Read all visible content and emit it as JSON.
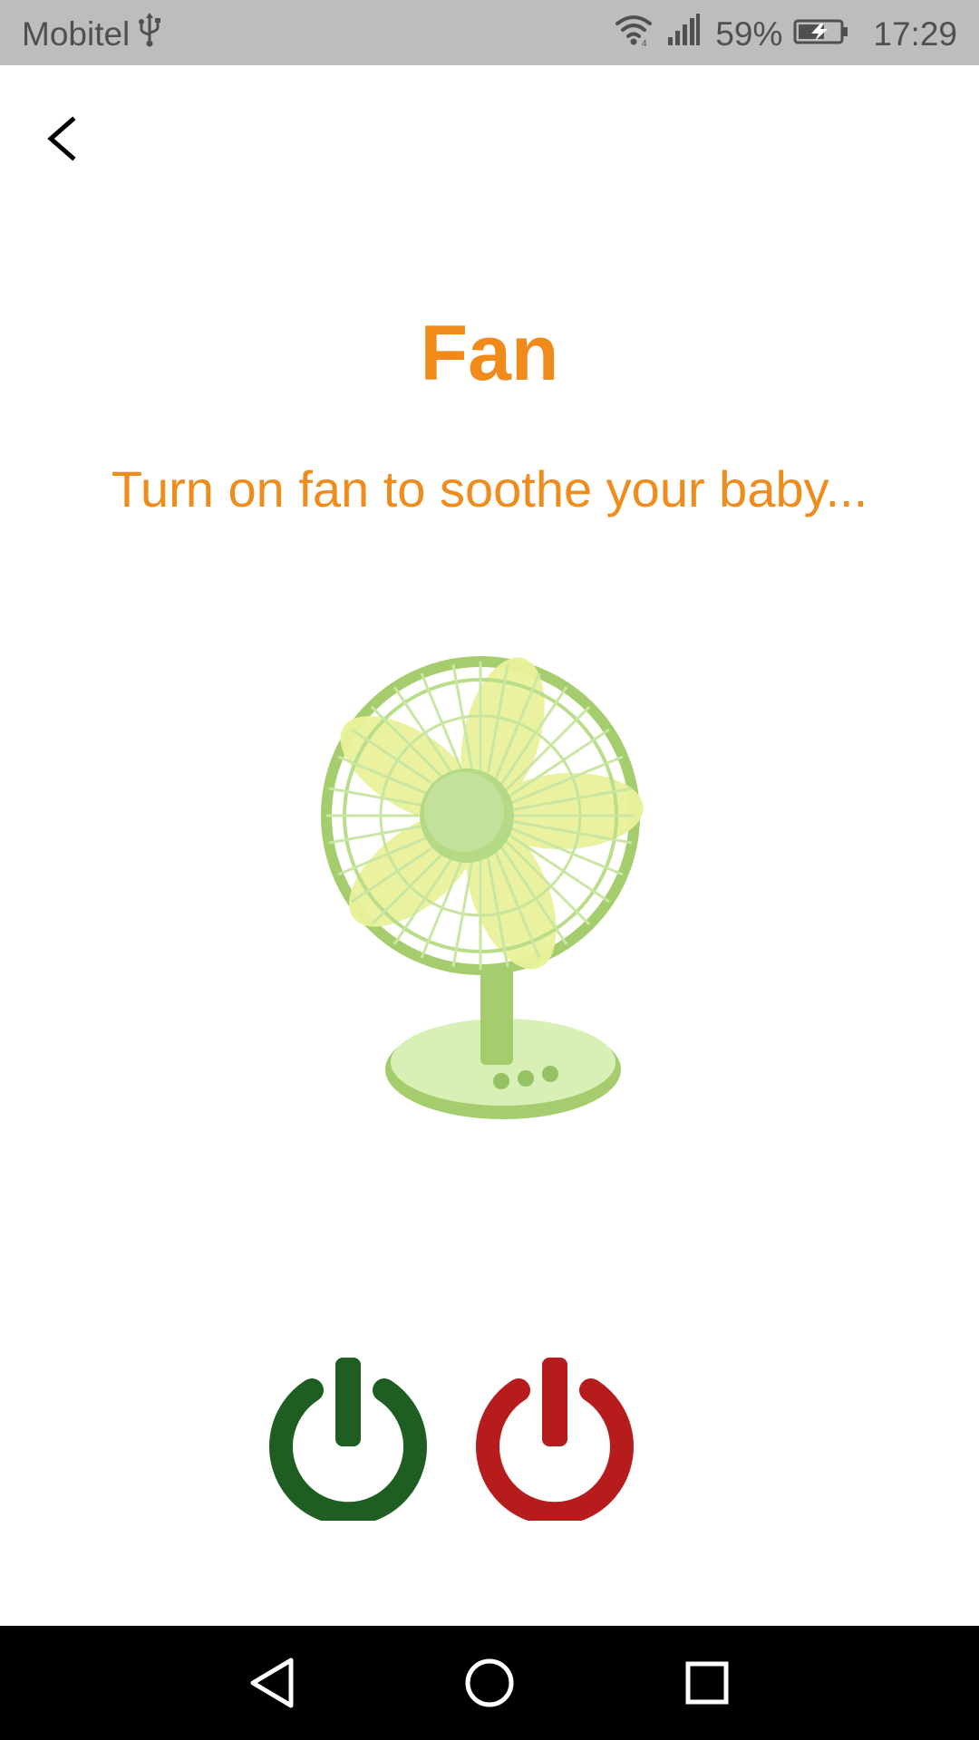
{
  "status_bar": {
    "carrier": "Mobitel",
    "battery_percent": "59%",
    "time": "17:29",
    "icons": [
      "usb-icon",
      "wifi-icon",
      "signal-icon",
      "battery-charging-icon"
    ]
  },
  "header": {
    "back_icon": "chevron-left-icon"
  },
  "main": {
    "title": "Fan",
    "subtitle": "Turn on fan to soothe your baby...",
    "illustration": "desk-fan",
    "power_on_icon": "power-icon",
    "power_on_color": "#1e5e22",
    "power_off_icon": "power-icon",
    "power_off_color": "#b71c1c"
  },
  "colors": {
    "accent": "#f08a1a",
    "status_bar_bg": "#bdbdbd",
    "nav_bar_bg": "#000000",
    "fan_green": "#9ccc65"
  },
  "nav_bar": {
    "buttons": [
      "back-triangle-icon",
      "home-circle-icon",
      "recents-square-icon"
    ]
  }
}
